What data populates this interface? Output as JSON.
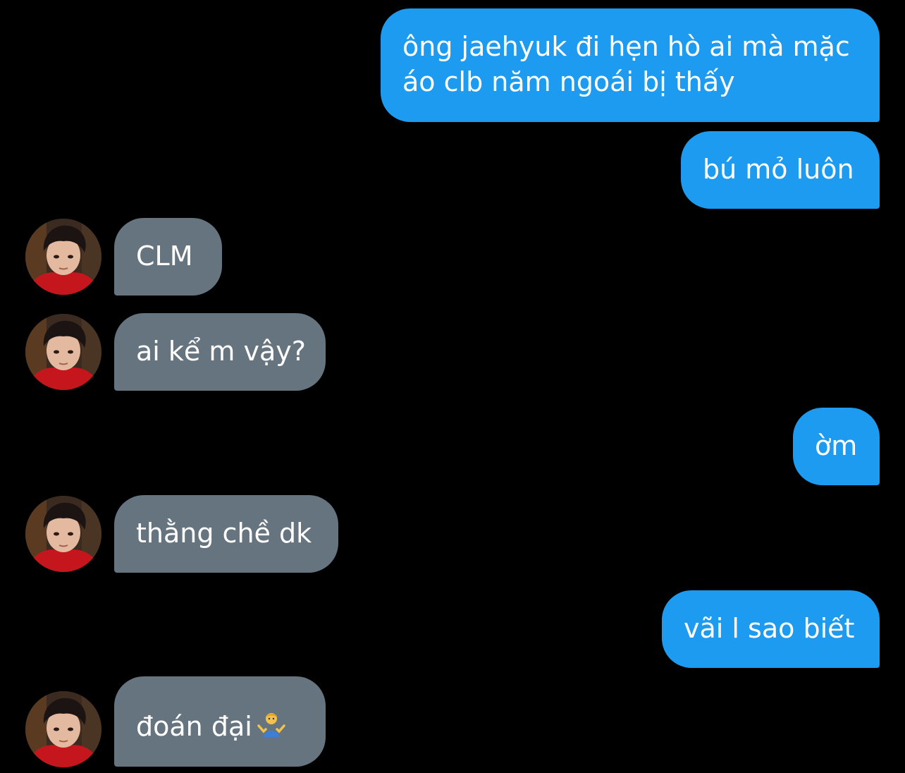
{
  "conversation": {
    "messages": [
      {
        "direction": "outgoing",
        "lines": [
          "ông jaehyuk đi hẹn hò ai mà mặc",
          "áo clb năm ngoái bị thấy"
        ]
      },
      {
        "direction": "outgoing",
        "text": "bú mỏ luôn"
      },
      {
        "direction": "incoming",
        "text": "CLM"
      },
      {
        "direction": "incoming",
        "text": "ai kể m vậy?"
      },
      {
        "direction": "outgoing",
        "text": "ờm"
      },
      {
        "direction": "incoming",
        "text": "thằng chề dk"
      },
      {
        "direction": "outgoing",
        "text": "vãi l sao biết"
      },
      {
        "direction": "incoming",
        "text": "đoán đại",
        "emoji": "person-shrugging-emoji"
      }
    ]
  },
  "colors": {
    "background": "#000000",
    "outgoing_bubble": "#1d9bf0",
    "incoming_bubble": "#66747f",
    "text": "#ffffff"
  },
  "icons": {
    "avatar": "contact-avatar-photo",
    "emoji": "person-shrugging-emoji"
  }
}
